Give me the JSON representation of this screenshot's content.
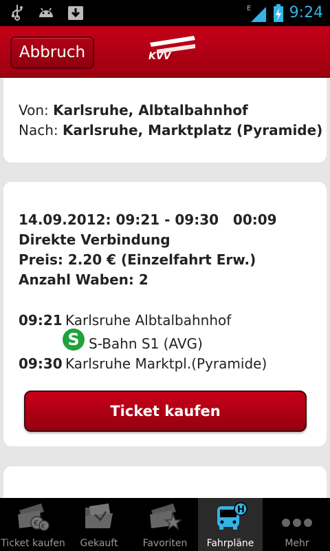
{
  "status_bar": {
    "time": "9:24",
    "network": "E",
    "icons": [
      "usb-icon",
      "android-icon",
      "download-icon",
      "signal-icon",
      "battery-icon"
    ]
  },
  "header": {
    "cancel_label": "Abbruch",
    "logo_text": "KVV"
  },
  "route": {
    "from_label": "Von:",
    "from_value": "Karlsruhe, Albtalbahnhof",
    "to_label": "Nach:",
    "to_value": "Karlsruhe, Marktplatz (Pyramide)"
  },
  "connection": {
    "summary": "14.09.2012: 09:21 - 09:30   00:09",
    "type": "Direkte Verbindung",
    "price": "Preis: 2.20 € (Einzelfahrt Erw.)",
    "zones": "Anzahl Waben: 2",
    "legs": [
      {
        "time": "09:21",
        "stop": "Karlsruhe Albtalbahnhof"
      },
      {
        "time": "09:30",
        "stop": "Karlsruhe Marktpl.(Pyramide)"
      }
    ],
    "line_icon": "S",
    "line_label": "S-Bahn S1 (AVG)",
    "buy_label": "Ticket kaufen"
  },
  "tabs": [
    {
      "label": "Ticket kaufen",
      "icon": "ticket-euro-icon",
      "active": false
    },
    {
      "label": "Gekauft",
      "icon": "purchased-folder-icon",
      "active": false
    },
    {
      "label": "Favoriten",
      "icon": "favorites-star-icon",
      "active": false
    },
    {
      "label": "Fahrpläne",
      "icon": "bus-stop-icon",
      "active": true
    },
    {
      "label": "Mehr",
      "icon": "more-icon",
      "active": false
    }
  ],
  "colors": {
    "brand_red": "#b20016",
    "active_tab_icon": "#33b5e5",
    "sbahn_green": "#1fa23b"
  }
}
